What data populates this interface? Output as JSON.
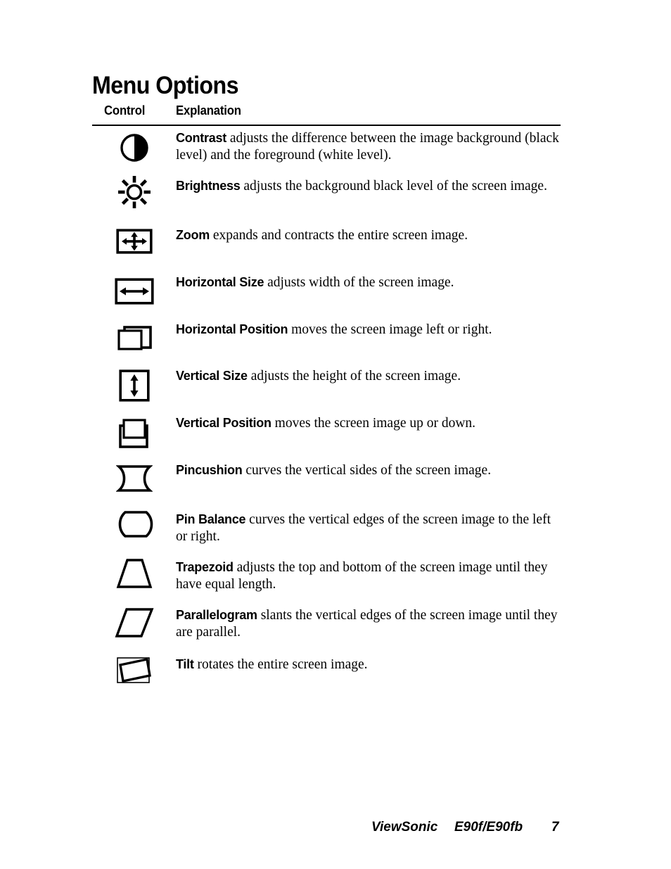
{
  "document": {
    "title": "Menu Options"
  },
  "table": {
    "headers": {
      "control": "Control",
      "explanation": "Explanation"
    },
    "rows": [
      {
        "icon": "contrast-icon",
        "term": "Contrast",
        "description": " adjusts the difference between the image background (black level) and the foreground (white level)."
      },
      {
        "icon": "brightness-icon",
        "term": "Brightness",
        "description": " adjusts the background black level of the screen image."
      },
      {
        "icon": "zoom-icon",
        "term": "Zoom",
        "description": " expands and contracts the entire screen image."
      },
      {
        "icon": "horizontal-size-icon",
        "term": "Horizontal Size",
        "description": " adjusts width of the screen image."
      },
      {
        "icon": "horizontal-position-icon",
        "term": "Horizontal Position",
        "description": " moves the screen image left or right."
      },
      {
        "icon": "vertical-size-icon",
        "term": "Vertical Size",
        "description": " adjusts the height of the screen image."
      },
      {
        "icon": "vertical-position-icon",
        "term": "Vertical Position",
        "description": " moves the screen image up or down."
      },
      {
        "icon": "pincushion-icon",
        "term": "Pincushion",
        "description": " curves the vertical sides of the screen image."
      },
      {
        "icon": "pin-balance-icon",
        "term": "Pin Balance",
        "description": " curves the vertical edges of the screen image to the left or right."
      },
      {
        "icon": "trapezoid-icon",
        "term": "Trapezoid",
        "description": " adjusts the top and bottom of the screen image until they have equal length."
      },
      {
        "icon": "parallelogram-icon",
        "term": "Parallelogram",
        "description": " slants the vertical edges of the screen image until they are parallel."
      },
      {
        "icon": "tilt-icon",
        "term": "Tilt",
        "description": " rotates the entire screen image."
      }
    ]
  },
  "footer": {
    "brand": "ViewSonic",
    "model": "E90f/E90fb",
    "page_number": "7"
  },
  "colors": {
    "ink": "#000000",
    "paper": "#ffffff"
  }
}
